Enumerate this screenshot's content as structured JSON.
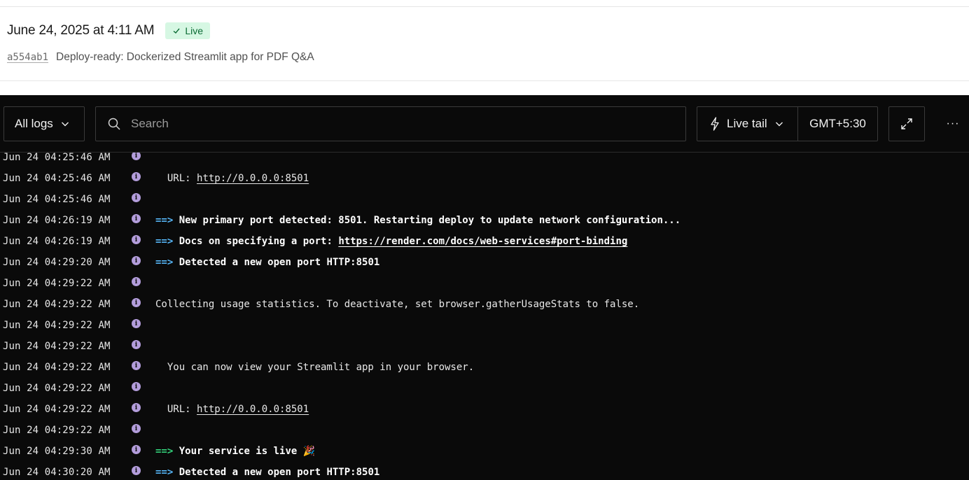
{
  "deploy": {
    "date": "June 24, 2025 at 4:11 AM",
    "status": "Live",
    "commit_hash": "a554ab1",
    "commit_message": "Deploy-ready: Dockerized Streamlit app for PDF Q&A"
  },
  "toolbar": {
    "log_filter": "All logs",
    "search_placeholder": "Search",
    "live_tail_label": "Live tail",
    "timezone": "GMT+5:30",
    "more_label": "···"
  },
  "icons": {
    "check": "check-icon",
    "chevron": "chevron-down-icon",
    "search": "search-icon",
    "live_tail": "lightning-bolt-icon",
    "expand": "expand-icon",
    "info": "info-icon"
  },
  "colors": {
    "live_badge_bg": "#d6f7e3",
    "live_badge_text": "#0b6b34",
    "log_bg": "#0a0a0a",
    "info_dot": "#b39ddb",
    "arrow_blue": "#56b6f7",
    "arrow_green": "#33d17a"
  },
  "logs": [
    {
      "ts": "Jun 24 04:25:46 AM",
      "arrow": "",
      "text": "",
      "link": "",
      "suffix": "",
      "bold": false
    },
    {
      "ts": "Jun 24 04:25:46 AM",
      "arrow": "",
      "text": "  URL: ",
      "link": "http://0.0.0.0:8501",
      "suffix": "",
      "bold": false
    },
    {
      "ts": "Jun 24 04:25:46 AM",
      "arrow": "",
      "text": "",
      "link": "",
      "suffix": "",
      "bold": false
    },
    {
      "ts": "Jun 24 04:26:19 AM",
      "arrow": "==>",
      "arrow_color": "blue",
      "text": " New primary port detected: 8501. Restarting deploy to update network configuration...",
      "link": "",
      "suffix": "",
      "bold": true
    },
    {
      "ts": "Jun 24 04:26:19 AM",
      "arrow": "==>",
      "arrow_color": "blue",
      "text": " Docs on specifying a port: ",
      "link": "https://render.com/docs/web-services#port-binding",
      "suffix": "",
      "bold": true
    },
    {
      "ts": "Jun 24 04:29:20 AM",
      "arrow": "==>",
      "arrow_color": "blue",
      "text": " Detected a new open port HTTP:8501",
      "link": "",
      "suffix": "",
      "bold": true
    },
    {
      "ts": "Jun 24 04:29:22 AM",
      "arrow": "",
      "text": "",
      "link": "",
      "suffix": "",
      "bold": false
    },
    {
      "ts": "Jun 24 04:29:22 AM",
      "arrow": "",
      "text": "Collecting usage statistics. To deactivate, set browser.gatherUsageStats to false.",
      "link": "",
      "suffix": "",
      "bold": false
    },
    {
      "ts": "Jun 24 04:29:22 AM",
      "arrow": "",
      "text": "",
      "link": "",
      "suffix": "",
      "bold": false
    },
    {
      "ts": "Jun 24 04:29:22 AM",
      "arrow": "",
      "text": "",
      "link": "",
      "suffix": "",
      "bold": false
    },
    {
      "ts": "Jun 24 04:29:22 AM",
      "arrow": "",
      "text": "  You can now view your Streamlit app in your browser.",
      "link": "",
      "suffix": "",
      "bold": false
    },
    {
      "ts": "Jun 24 04:29:22 AM",
      "arrow": "",
      "text": "",
      "link": "",
      "suffix": "",
      "bold": false
    },
    {
      "ts": "Jun 24 04:29:22 AM",
      "arrow": "",
      "text": "  URL: ",
      "link": "http://0.0.0.0:8501",
      "suffix": "",
      "bold": false
    },
    {
      "ts": "Jun 24 04:29:22 AM",
      "arrow": "",
      "text": "",
      "link": "",
      "suffix": "",
      "bold": false
    },
    {
      "ts": "Jun 24 04:29:30 AM",
      "arrow": "==>",
      "arrow_color": "green",
      "text": " Your service is live 🎉",
      "link": "",
      "suffix": "",
      "bold": true
    },
    {
      "ts": "Jun 24 04:30:20 AM",
      "arrow": "==>",
      "arrow_color": "blue",
      "text": " Detected a new open port HTTP:8501",
      "link": "",
      "suffix": "",
      "bold": true
    }
  ]
}
